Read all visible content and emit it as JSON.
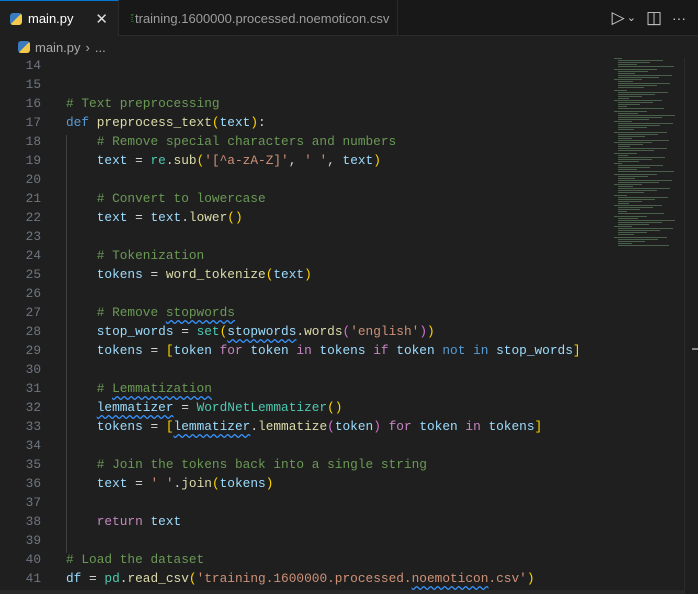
{
  "tabs": [
    {
      "label": "main.py",
      "icon": "python-icon",
      "active": true
    },
    {
      "label": "training.1600000.processed.noemoticon.csv",
      "icon": "csv-icon",
      "active": false
    }
  ],
  "actions": {
    "run": "▷",
    "run_menu": "⌄",
    "split": "◫",
    "more": "···",
    "close": "✕"
  },
  "breadcrumb": {
    "file": "main.py",
    "sep": "›",
    "rest": "..."
  },
  "code": [
    {
      "n": "14",
      "t": []
    },
    {
      "n": "15",
      "t": []
    },
    {
      "n": "16",
      "t": [
        [
          "c",
          "# Text preprocessing"
        ]
      ]
    },
    {
      "n": "17",
      "t": [
        [
          "k",
          "def "
        ],
        [
          "f",
          "preprocess_text"
        ],
        [
          "p1",
          "("
        ],
        [
          "v",
          "text"
        ],
        [
          "p1",
          ")"
        ],
        [
          "o",
          ":"
        ]
      ]
    },
    {
      "n": "18",
      "t": [
        [
          "o",
          "    "
        ],
        [
          "c",
          "# Remove special characters and numbers"
        ]
      ]
    },
    {
      "n": "19",
      "t": [
        [
          "o",
          "    "
        ],
        [
          "v",
          "text"
        ],
        [
          "o",
          " = "
        ],
        [
          "m",
          "re"
        ],
        [
          "o",
          "."
        ],
        [
          "f",
          "sub"
        ],
        [
          "p1",
          "("
        ],
        [
          "s",
          "'[^a-zA-Z]'"
        ],
        [
          "o",
          ", "
        ],
        [
          "s",
          "' '"
        ],
        [
          "o",
          ", "
        ],
        [
          "v",
          "text"
        ],
        [
          "p1",
          ")"
        ]
      ]
    },
    {
      "n": "20",
      "t": []
    },
    {
      "n": "21",
      "t": [
        [
          "o",
          "    "
        ],
        [
          "c",
          "# Convert to lowercase"
        ]
      ]
    },
    {
      "n": "22",
      "t": [
        [
          "o",
          "    "
        ],
        [
          "v",
          "text"
        ],
        [
          "o",
          " = "
        ],
        [
          "v",
          "text"
        ],
        [
          "o",
          "."
        ],
        [
          "f",
          "lower"
        ],
        [
          "p1",
          "()"
        ]
      ]
    },
    {
      "n": "23",
      "t": []
    },
    {
      "n": "24",
      "t": [
        [
          "o",
          "    "
        ],
        [
          "c",
          "# Tokenization"
        ]
      ]
    },
    {
      "n": "25",
      "t": [
        [
          "o",
          "    "
        ],
        [
          "v",
          "tokens"
        ],
        [
          "o",
          " = "
        ],
        [
          "f",
          "word_tokenize"
        ],
        [
          "p1",
          "("
        ],
        [
          "v",
          "text"
        ],
        [
          "p1",
          ")"
        ]
      ]
    },
    {
      "n": "26",
      "t": []
    },
    {
      "n": "27",
      "t": [
        [
          "o",
          "    "
        ],
        [
          "c",
          "# Remove "
        ],
        [
          "c sq",
          "stopwords"
        ]
      ]
    },
    {
      "n": "28",
      "t": [
        [
          "o",
          "    "
        ],
        [
          "v",
          "stop_words"
        ],
        [
          "o",
          " = "
        ],
        [
          "m",
          "set"
        ],
        [
          "p1",
          "("
        ],
        [
          "v sq",
          "stopwords"
        ],
        [
          "o",
          "."
        ],
        [
          "f",
          "words"
        ],
        [
          "p2",
          "("
        ],
        [
          "s",
          "'english'"
        ],
        [
          "p2",
          ")"
        ],
        [
          "p1",
          ")"
        ]
      ]
    },
    {
      "n": "29",
      "t": [
        [
          "o",
          "    "
        ],
        [
          "v",
          "tokens"
        ],
        [
          "o",
          " = "
        ],
        [
          "p1",
          "["
        ],
        [
          "v",
          "token "
        ],
        [
          "ctl",
          "for "
        ],
        [
          "v",
          "token "
        ],
        [
          "ctl",
          "in "
        ],
        [
          "v",
          "tokens "
        ],
        [
          "ctl",
          "if "
        ],
        [
          "v",
          "token "
        ],
        [
          "k",
          "not in "
        ],
        [
          "v",
          "stop_words"
        ],
        [
          "p1",
          "]"
        ]
      ]
    },
    {
      "n": "30",
      "t": []
    },
    {
      "n": "31",
      "t": [
        [
          "o",
          "    "
        ],
        [
          "c",
          "# "
        ],
        [
          "c sq",
          "Lemmatization"
        ]
      ]
    },
    {
      "n": "32",
      "t": [
        [
          "o",
          "    "
        ],
        [
          "v sq",
          "lemmatizer"
        ],
        [
          "o",
          " = "
        ],
        [
          "m",
          "WordNetLemmatizer"
        ],
        [
          "p1",
          "()"
        ]
      ]
    },
    {
      "n": "33",
      "t": [
        [
          "o",
          "    "
        ],
        [
          "v",
          "tokens"
        ],
        [
          "o",
          " = "
        ],
        [
          "p1",
          "["
        ],
        [
          "v sq",
          "lemmatizer"
        ],
        [
          "o",
          "."
        ],
        [
          "f",
          "lemmatize"
        ],
        [
          "p2",
          "("
        ],
        [
          "v",
          "token"
        ],
        [
          "p2",
          ")"
        ],
        [
          "ctl",
          " for "
        ],
        [
          "v",
          "token "
        ],
        [
          "ctl",
          "in "
        ],
        [
          "v",
          "tokens"
        ],
        [
          "p1",
          "]"
        ]
      ]
    },
    {
      "n": "34",
      "t": []
    },
    {
      "n": "35",
      "t": [
        [
          "o",
          "    "
        ],
        [
          "c",
          "# Join the tokens back into a single string"
        ]
      ]
    },
    {
      "n": "36",
      "t": [
        [
          "o",
          "    "
        ],
        [
          "v",
          "text"
        ],
        [
          "o",
          " = "
        ],
        [
          "s",
          "' '"
        ],
        [
          "o",
          "."
        ],
        [
          "f",
          "join"
        ],
        [
          "p1",
          "("
        ],
        [
          "v",
          "tokens"
        ],
        [
          "p1",
          ")"
        ]
      ]
    },
    {
      "n": "37",
      "t": []
    },
    {
      "n": "38",
      "t": [
        [
          "o",
          "    "
        ],
        [
          "ctl",
          "return "
        ],
        [
          "v",
          "text"
        ]
      ]
    },
    {
      "n": "39",
      "t": []
    },
    {
      "n": "40",
      "t": [
        [
          "c",
          "# Load the dataset"
        ]
      ]
    },
    {
      "n": "41",
      "t": [
        [
          "v",
          "df"
        ],
        [
          "o",
          " = "
        ],
        [
          "m",
          "pd"
        ],
        [
          "o",
          "."
        ],
        [
          "f",
          "read_csv"
        ],
        [
          "p1",
          "("
        ],
        [
          "s",
          "'training.1600000.processed."
        ],
        [
          "s sq",
          "noemoticon"
        ],
        [
          "s",
          ".csv'"
        ],
        [
          "p1",
          ")"
        ]
      ]
    }
  ]
}
